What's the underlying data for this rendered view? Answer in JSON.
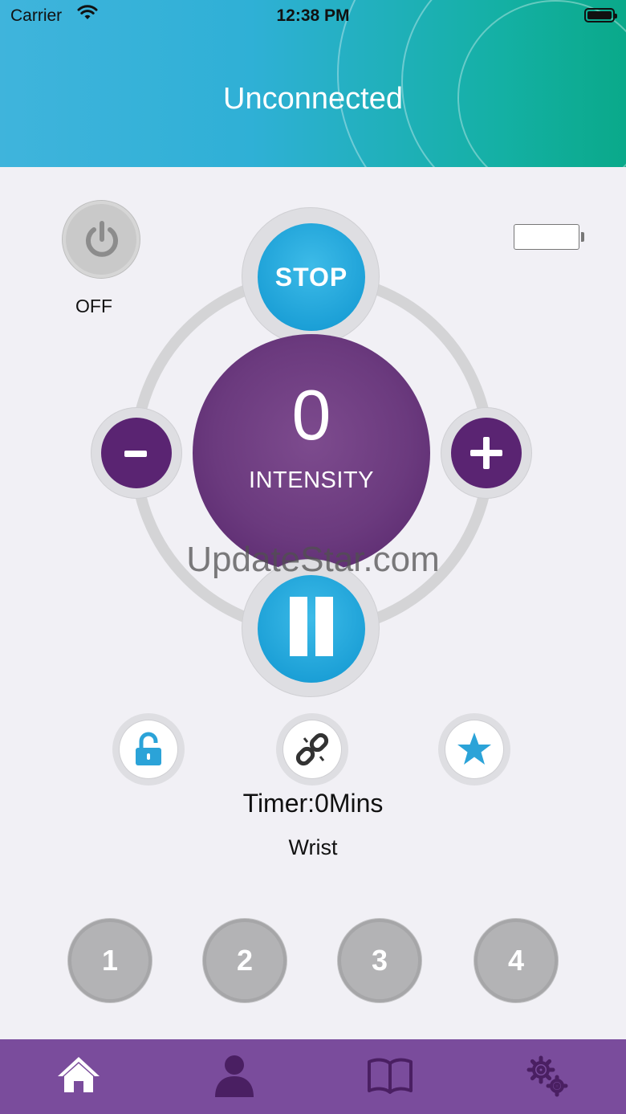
{
  "status_bar": {
    "carrier": "Carrier",
    "time": "12:38 PM"
  },
  "header": {
    "title": "Unconnected"
  },
  "power": {
    "label": "OFF",
    "icon": "power-icon"
  },
  "device_battery": {
    "icon": "battery-empty-icon"
  },
  "controls": {
    "stop_label": "STOP",
    "intensity_value": "0",
    "intensity_label": "INTENSITY",
    "minus_label": "-",
    "plus_label": "+",
    "pause_icon": "pause-icon"
  },
  "watermark": "UpdateStar.com",
  "actions": [
    {
      "icon": "unlock-icon"
    },
    {
      "icon": "unlink-icon"
    },
    {
      "icon": "star-icon"
    }
  ],
  "timer": "Timer:0Mins",
  "location": "Wrist",
  "presets": [
    "1",
    "2",
    "3",
    "4"
  ],
  "tabbar": [
    {
      "icon": "home-icon",
      "active": true
    },
    {
      "icon": "user-icon"
    },
    {
      "icon": "book-icon"
    },
    {
      "icon": "settings-icon"
    }
  ],
  "colors": {
    "header_start": "#3fb4dc",
    "header_end": "#0aa98a",
    "accent_blue": "#1b9fd6",
    "purple": "#5a2472",
    "tabbar": "#7a4c9c"
  }
}
